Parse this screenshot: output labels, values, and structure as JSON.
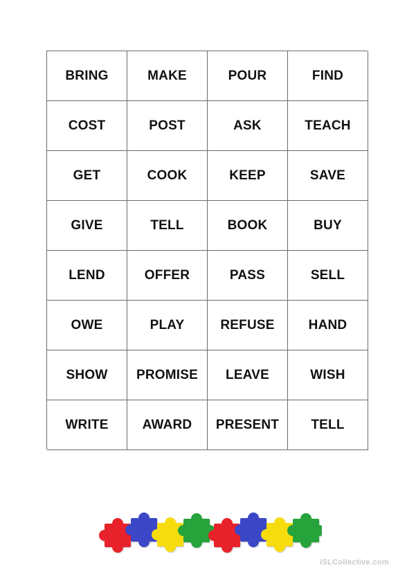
{
  "worksheet": {
    "rows": [
      [
        "BRING",
        "MAKE",
        "POUR",
        "FIND"
      ],
      [
        "COST",
        "POST",
        "ASK",
        "TEACH"
      ],
      [
        "GET",
        "COOK",
        "KEEP",
        "SAVE"
      ],
      [
        "GIVE",
        "TELL",
        "BOOK",
        "BUY"
      ],
      [
        "LEND",
        "OFFER",
        "PASS",
        "SELL"
      ],
      [
        "OWE",
        "PLAY",
        "REFUSE",
        "HAND"
      ],
      [
        "SHOW",
        "PROMISE",
        "LEAVE",
        "WISH"
      ],
      [
        "WRITE",
        "AWARD",
        "PRESENT",
        "TELL"
      ]
    ]
  },
  "decoration": {
    "icon": "puzzle-pieces-icon",
    "colors": [
      "#e8212b",
      "#3b47c6",
      "#f7dc11",
      "#26a33a"
    ]
  },
  "footer": {
    "watermark": "iSLCollective.com"
  }
}
